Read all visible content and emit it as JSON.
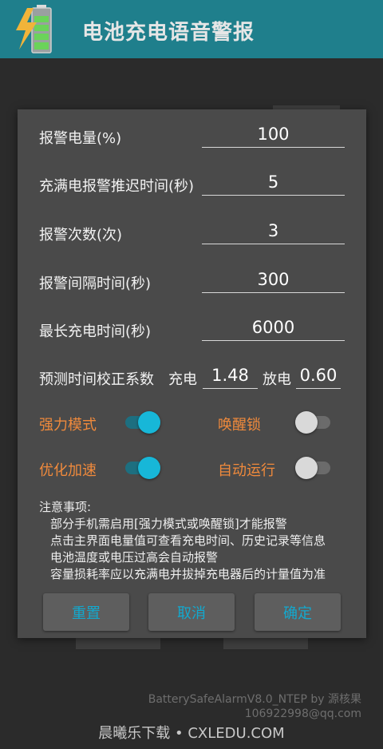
{
  "app": {
    "title": "电池充电语音警报",
    "icon": "battery-charging-icon"
  },
  "dialog": {
    "fields": [
      {
        "label": "报警电量(%)",
        "value": "100"
      },
      {
        "label": "充满电报警推迟时间(秒)",
        "value": "5"
      },
      {
        "label": "报警次数(次)",
        "value": "3"
      },
      {
        "label": "报警间隔时间(秒)",
        "value": "300"
      },
      {
        "label": "最长充电时间(秒)",
        "value": "6000"
      }
    ],
    "calibration": {
      "label": "预测时间校正系数",
      "charge_label": "充电",
      "charge_value": "1.48",
      "discharge_label": "放电",
      "discharge_value": "0.60"
    },
    "toggles": [
      {
        "label": "强力模式",
        "on": true
      },
      {
        "label": "唤醒锁",
        "on": false
      },
      {
        "label": "优化加速",
        "on": true
      },
      {
        "label": "自动运行",
        "on": false
      }
    ],
    "notes": {
      "title": "注意事项:",
      "lines": [
        "部分手机需启用[强力模式或唤醒锁]才能报警",
        "点击主界面电量值可查看充电时间、历史记录等信息",
        "电池温度或电压过高会自动报警",
        "容量损耗率应以充满电并拔掉充电器后的计量值为准"
      ]
    },
    "buttons": {
      "reset": "重置",
      "cancel": "取消",
      "ok": "确定"
    }
  },
  "footer": {
    "credit_line1": "BatterySafeAlarmV8.0_NTEP by 源核果",
    "credit_line2": "106922998@qq.com",
    "watermark": "晨曦乐下载 • CXLEDU.COM"
  },
  "colors": {
    "app_bar": "#1f7f8c",
    "toggle_label": "#f08a3c",
    "accent": "#17b7d8",
    "button_text": "#12a9cf"
  }
}
